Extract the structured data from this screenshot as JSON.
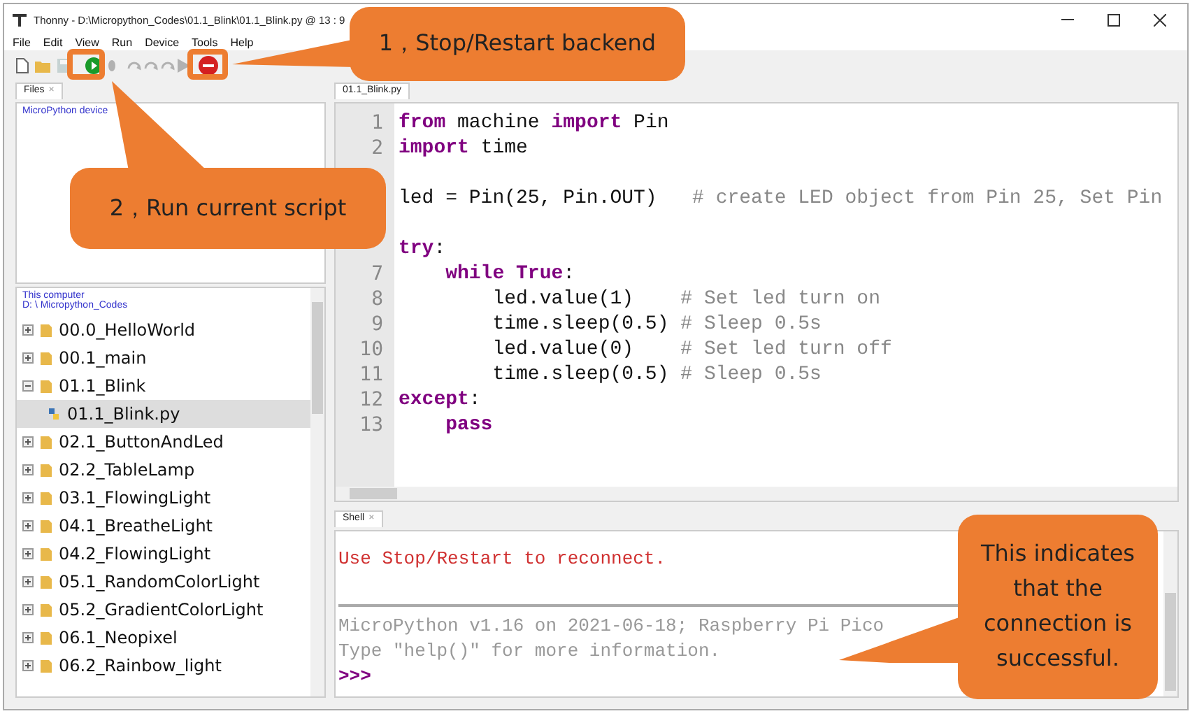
{
  "window": {
    "title": "Thonny - D:\\Micropython_Codes\\01.1_Blink\\01.1_Blink.py @ 13 : 9"
  },
  "menu": [
    "File",
    "Edit",
    "View",
    "Run",
    "Device",
    "Tools",
    "Help"
  ],
  "toolbar": [
    {
      "kind": "new",
      "disabled": false
    },
    {
      "kind": "open",
      "disabled": false
    },
    {
      "kind": "save",
      "disabled": true
    },
    {
      "kind": "run",
      "disabled": false
    },
    {
      "kind": "debug",
      "disabled": true
    },
    {
      "kind": "over",
      "disabled": true
    },
    {
      "kind": "into",
      "disabled": true
    },
    {
      "kind": "out",
      "disabled": true
    },
    {
      "kind": "resume",
      "disabled": true
    },
    {
      "kind": "stop",
      "disabled": false
    }
  ],
  "files_tab": {
    "label": "Files",
    "close": "×"
  },
  "device_pane": {
    "title": "MicroPython device"
  },
  "computer_pane": {
    "title": "This computer",
    "path": "D: \\ Micropython_Codes"
  },
  "tree": [
    {
      "name": "00.0_HelloWorld",
      "expanded": false,
      "selected": false
    },
    {
      "name": "00.1_main",
      "expanded": false,
      "selected": false
    },
    {
      "name": "01.1_Blink",
      "expanded": true,
      "selected": false,
      "children": [
        {
          "name": "01.1_Blink.py",
          "selected": true
        }
      ]
    },
    {
      "name": "02.1_ButtonAndLed",
      "expanded": false,
      "selected": false
    },
    {
      "name": "02.2_TableLamp",
      "expanded": false,
      "selected": false
    },
    {
      "name": "03.1_FlowingLight",
      "expanded": false,
      "selected": false
    },
    {
      "name": "04.1_BreatheLight",
      "expanded": false,
      "selected": false
    },
    {
      "name": "04.2_FlowingLight",
      "expanded": false,
      "selected": false
    },
    {
      "name": "05.1_RandomColorLight",
      "expanded": false,
      "selected": false
    },
    {
      "name": "05.2_GradientColorLight",
      "expanded": false,
      "selected": false
    },
    {
      "name": "06.1_Neopixel",
      "expanded": false,
      "selected": false
    },
    {
      "name": "06.2_Rainbow_light",
      "expanded": false,
      "selected": false
    }
  ],
  "editor_tab": {
    "label": "01.1_Blink.py"
  },
  "code": [
    {
      "kind": "code",
      "number": "1",
      "tokens": [
        {
          "kind": "keyword",
          "text": "from"
        },
        {
          "kind": "plain",
          "text": " machine "
        },
        {
          "kind": "keyword",
          "text": "import"
        },
        {
          "kind": "plain",
          "text": " Pin"
        }
      ]
    },
    {
      "kind": "code",
      "number": "2",
      "tokens": [
        {
          "kind": "keyword",
          "text": "import"
        },
        {
          "kind": "plain",
          "text": " time"
        }
      ]
    },
    {
      "kind": "blank"
    },
    {
      "kind": "code",
      "tokens": [
        {
          "kind": "plain",
          "text": "led = Pin(25, Pin.OUT)   "
        },
        {
          "kind": "comment",
          "text": "# create LED object from Pin 25, Set Pin"
        }
      ]
    },
    {
      "kind": "blank"
    },
    {
      "kind": "code",
      "tokens": [
        {
          "kind": "keyword",
          "text": "try"
        },
        {
          "kind": "plain",
          "text": ":"
        }
      ]
    },
    {
      "kind": "code",
      "number": "7",
      "tokens": [
        {
          "kind": "keyword",
          "text": "    while"
        },
        {
          "kind": "keyword",
          "text": " True"
        },
        {
          "kind": "plain",
          "text": ":"
        }
      ]
    },
    {
      "kind": "code",
      "number": "8",
      "tokens": [
        {
          "kind": "plain",
          "text": "        led.value(1)    "
        },
        {
          "kind": "comment",
          "text": "# Set led turn on"
        }
      ]
    },
    {
      "kind": "code",
      "number": "9",
      "tokens": [
        {
          "kind": "plain",
          "text": "        time.sleep(0.5) "
        },
        {
          "kind": "comment",
          "text": "# Sleep 0.5s"
        }
      ]
    },
    {
      "kind": "code",
      "number": "10",
      "tokens": [
        {
          "kind": "plain",
          "text": "        led.value(0)    "
        },
        {
          "kind": "comment",
          "text": "# Set led turn off"
        }
      ]
    },
    {
      "kind": "code",
      "number": "11",
      "tokens": [
        {
          "kind": "plain",
          "text": "        time.sleep(0.5) "
        },
        {
          "kind": "comment",
          "text": "# Sleep 0.5s"
        }
      ]
    },
    {
      "kind": "code",
      "number": "12",
      "tokens": [
        {
          "kind": "keyword",
          "text": "except"
        },
        {
          "kind": "plain",
          "text": ":"
        }
      ]
    },
    {
      "kind": "code",
      "number": "13",
      "tokens": [
        {
          "kind": "keyword",
          "text": "    pass"
        }
      ]
    }
  ],
  "shell_tab": {
    "label": "Shell",
    "close": "×"
  },
  "shell": [
    {
      "kind": "error",
      "text": "Use Stop/Restart to reconnect."
    },
    {
      "kind": "separator"
    },
    {
      "kind": "info",
      "text": "MicroPython v1.16 on 2021-06-18; Raspberry Pi Pico"
    },
    {
      "kind": "info",
      "text": "Type \"help()\" for more information."
    },
    {
      "kind": "prompt",
      "text": ">>>"
    }
  ],
  "callouts": [
    {
      "text": "1，Stop/Restart backend"
    },
    {
      "text": "2，Run current script"
    },
    {
      "text": "This indicates that the connection is successful."
    }
  ]
}
